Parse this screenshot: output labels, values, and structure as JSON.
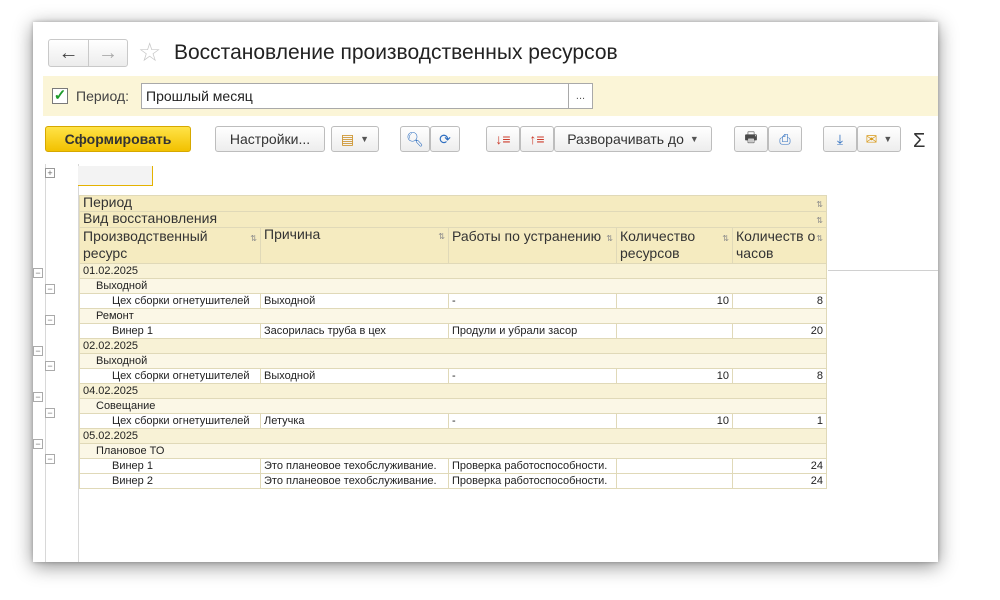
{
  "window": {
    "title": "Восстановление производственных ресурсов",
    "nav": {
      "back": "←",
      "forward": "→"
    }
  },
  "period": {
    "checked": true,
    "label": "Период:",
    "value": "Прошлый месяц",
    "select_label": "..."
  },
  "toolbar": {
    "generate": "Сформировать",
    "settings": "Настройки...",
    "expand_to": "Разворачивать до",
    "sigma": "Σ"
  },
  "report": {
    "headers": {
      "period": "Период",
      "kind": "Вид восстановления",
      "resource": "Производственный ресурс",
      "reason": "Причина",
      "works": "Работы по устранению",
      "qty_resources": "Количество ресурсов",
      "qty_hours": "Количеств о часов"
    },
    "rows": [
      {
        "level": 0,
        "label": "01.02.2025"
      },
      {
        "level": 1,
        "label": "Выходной"
      },
      {
        "level": 2,
        "label": "Цех сборки огнетушителей",
        "reason": "Выходной",
        "works": "-",
        "qty": "10",
        "hours": "8"
      },
      {
        "level": 1,
        "label": "Ремонт"
      },
      {
        "level": 2,
        "label": "Винер 1",
        "reason": "Засорилась труба в цех",
        "works": "Продули и убрали засор",
        "qty": "",
        "hours": "20"
      },
      {
        "level": 0,
        "label": "02.02.2025"
      },
      {
        "level": 1,
        "label": "Выходной"
      },
      {
        "level": 2,
        "label": "Цех сборки огнетушителей",
        "reason": "Выходной",
        "works": "-",
        "qty": "10",
        "hours": "8"
      },
      {
        "level": 0,
        "label": "04.02.2025"
      },
      {
        "level": 1,
        "label": "Совещание"
      },
      {
        "level": 2,
        "label": "Цех сборки огнетушителей",
        "reason": "Летучка",
        "works": "-",
        "qty": "10",
        "hours": "1"
      },
      {
        "level": 0,
        "label": "05.02.2025"
      },
      {
        "level": 1,
        "label": "Плановое ТО"
      },
      {
        "level": 2,
        "label": "Винер 1",
        "reason": "Это планеовое техобслуживание.",
        "works": "Проверка работоспособности.",
        "qty": "",
        "hours": "24"
      },
      {
        "level": 2,
        "label": "Винер 2",
        "reason": "Это планеовое техобслуживание.",
        "works": "Проверка работоспособности.",
        "qty": "",
        "hours": "24"
      }
    ]
  }
}
